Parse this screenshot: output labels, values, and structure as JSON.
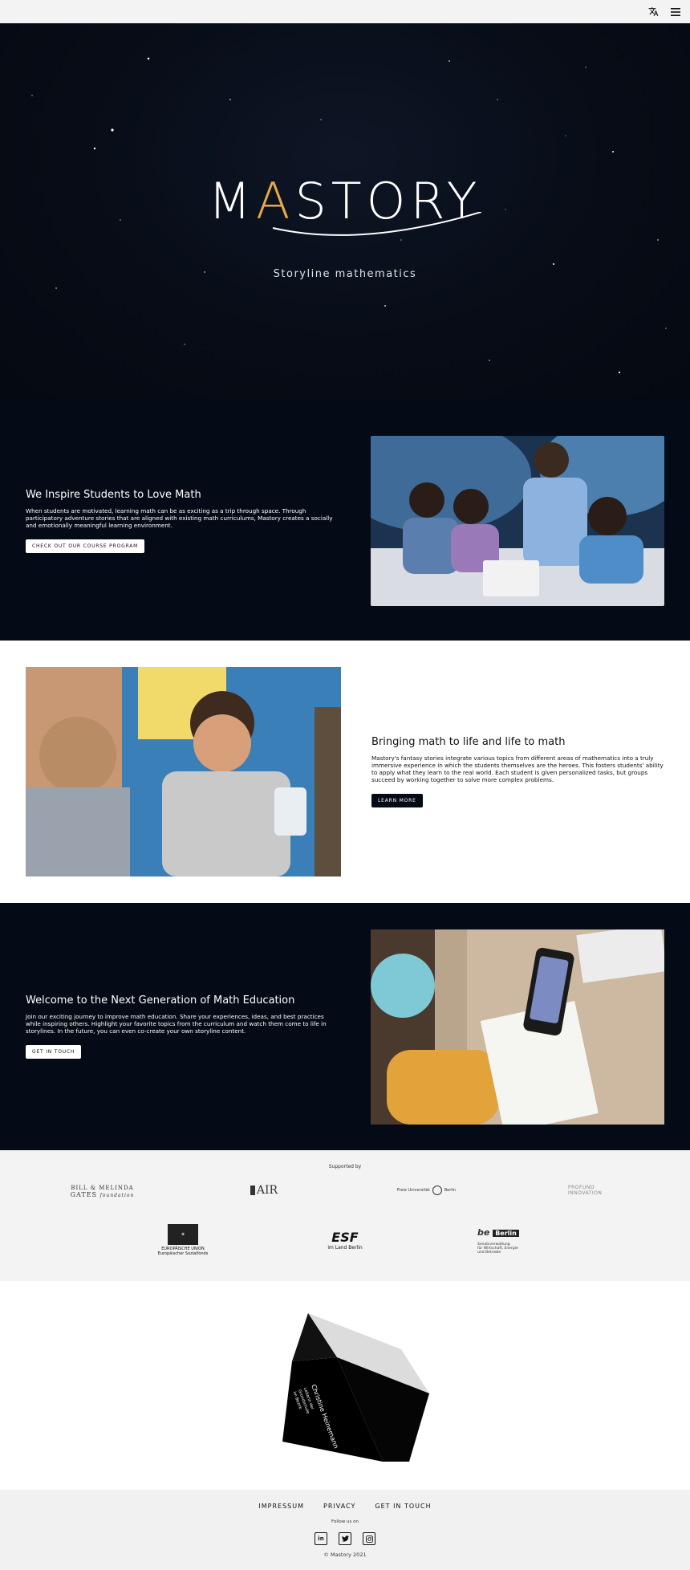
{
  "topbar": {
    "translate_icon": "translate-icon",
    "menu_icon": "hamburger-menu-icon"
  },
  "hero": {
    "logo_left": "M",
    "logo_a": "A",
    "logo_right": "STORY",
    "tagline": "Storyline mathematics"
  },
  "section1": {
    "heading": "We Inspire Students to Love Math",
    "body": "When students are motivated, learning math can be as exciting as a trip through space. Through participatory adventure stories that are aligned with existing math curriculums, Mastory creates a socially and emotionally meaningful learning environment.",
    "button": "CHECK OUT OUR COURSE PROGRAM"
  },
  "section2": {
    "heading": "Bringing math to life and life to math",
    "body": "Mastory's fantasy stories integrate various topics from different areas of mathematics into a truly immersive experience in which the students themselves are the heroes. This fosters students' ability to apply what they learn to the real world. Each student is given personalized tasks, but groups succeed by working together to solve more complex problems.",
    "button": "LEARN MORE"
  },
  "section3": {
    "heading": "Welcome to the Next Generation of Math Education",
    "body": "Join our exciting journey to improve math education. Share your experiences, ideas, and best practices while inspiring others. Highlight your favorite topics from the curriculum and watch them come to life in storylines. In the future, you can even co-create your own storyline content.",
    "button": "GET IN TOUCH"
  },
  "supporters": {
    "label": "Supported by",
    "gates_1": "BILL & MELINDA",
    "gates_2": "GATES",
    "gates_3": "foundation",
    "air": "AIR",
    "fu": "Freie Universität",
    "fu2": "Berlin",
    "profund_1": "PROFUND",
    "profund_2": "INNOVATION",
    "eu_1": "EUROPÄISCHE UNION",
    "eu_2": "Europäischer Sozialfonds",
    "esf_1": "ESF",
    "esf_2": "im Land Berlin",
    "berlin_1": "be",
    "berlin_2": "Berlin",
    "berlin_3": "Senatsverwaltung",
    "berlin_4": "für Wirtschaft, Energie",
    "berlin_5": "und Betriebe"
  },
  "cube": {
    "face_title": "Christine Heinemann",
    "face_lines": [
      "Leiterin der",
      "Grundschule",
      "im Bezirk"
    ]
  },
  "footer": {
    "links": [
      "IMPRESSUM",
      "PRIVACY",
      "GET IN TOUCH"
    ],
    "follow": "Follow us on",
    "social_icons": [
      "linkedin-icon",
      "twitter-icon",
      "instagram-icon"
    ],
    "copyright": "© Mastory 2021"
  }
}
